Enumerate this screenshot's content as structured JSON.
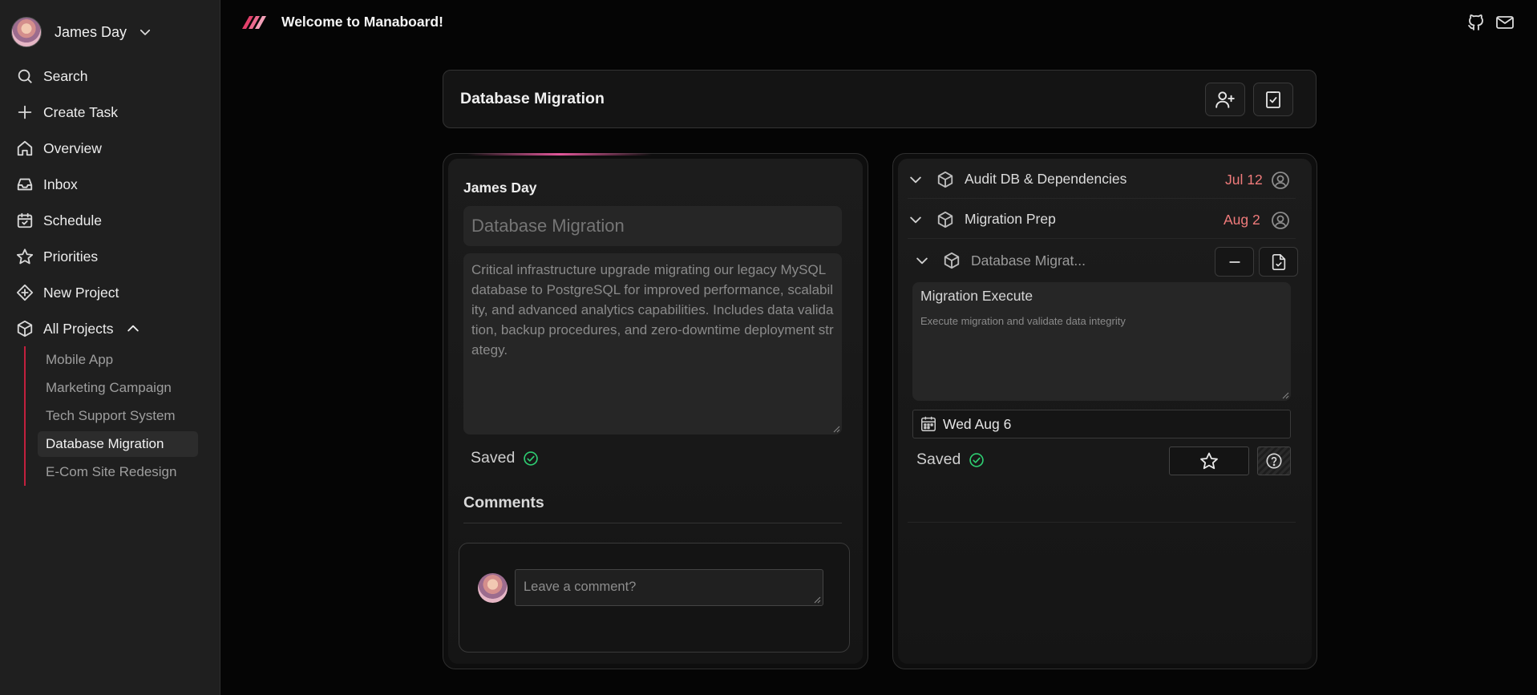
{
  "sidebar": {
    "user_name": "James Day",
    "nav": [
      {
        "label": "Search",
        "icon": "search-icon"
      },
      {
        "label": "Create Task",
        "icon": "plus-icon"
      },
      {
        "label": "Overview",
        "icon": "home-icon"
      },
      {
        "label": "Inbox",
        "icon": "inbox-icon"
      },
      {
        "label": "Schedule",
        "icon": "calendar-check-icon"
      },
      {
        "label": "Priorities",
        "icon": "star-icon"
      },
      {
        "label": "New Project",
        "icon": "diamond-plus-icon"
      },
      {
        "label": "All Projects",
        "icon": "cube-icon"
      }
    ],
    "projects": [
      {
        "label": "Mobile App"
      },
      {
        "label": "Marketing Campaign"
      },
      {
        "label": "Tech Support System"
      },
      {
        "label": "Database Migration",
        "active": true
      },
      {
        "label": "E-Com Site Redesign"
      }
    ]
  },
  "topbar": {
    "welcome": "Welcome to Manaboard!",
    "icons": [
      "github-icon",
      "mail-icon"
    ]
  },
  "header": {
    "title": "Database Migration",
    "buttons": [
      "add-user-icon",
      "clipboard-check-icon"
    ]
  },
  "project_panel": {
    "author": "James Day",
    "title_placeholder": "Database Migration",
    "description": "Critical infrastructure upgrade migrating our legacy MySQL database to PostgreSQL for improved performance, scalability, and advanced analytics capabilities. Includes data validation, backup procedures, and zero-downtime deployment strategy.",
    "saved": "Saved",
    "comments_heading": "Comments",
    "comment_placeholder": "Leave a comment?"
  },
  "task_panel": {
    "tasks": [
      {
        "name": "Audit DB & Dependencies",
        "date": "Jul 12"
      },
      {
        "name": "Migration Prep",
        "date": "Aug 2"
      },
      {
        "name": "Database Migrat..."
      }
    ],
    "subtask": {
      "name": "Migration Execute",
      "description": "Execute migration and validate data integrity",
      "date": "Wed Aug 6",
      "saved": "Saved"
    }
  },
  "colors": {
    "accent": "#c2203e",
    "date_red": "#f07b7b",
    "saved_green": "#2ecc71",
    "background": "#050505",
    "sidebar": "#1f1f1f"
  }
}
